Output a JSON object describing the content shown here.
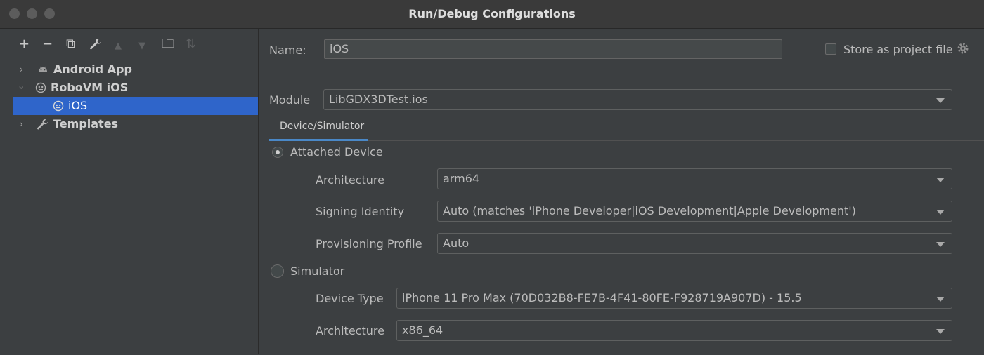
{
  "window": {
    "title": "Run/Debug Configurations"
  },
  "toolbar": {
    "icons": [
      "add-icon",
      "remove-icon",
      "copy-icon",
      "wrench-icon",
      "move-up-icon",
      "move-down-icon",
      "new-folder-icon",
      "sort-icon"
    ],
    "glyphs": {
      "add": "+",
      "remove": "−",
      "copy": "⧉",
      "wrench": "🔧",
      "up": "▲",
      "down": "▼",
      "folder": "🗀",
      "sort": "⇅"
    }
  },
  "tree": {
    "items": [
      {
        "label": "Android App",
        "icon": "android-icon"
      },
      {
        "label": "RoboVM iOS",
        "icon": "robovm-icon"
      },
      {
        "label": "iOS",
        "icon": "robovm-icon"
      },
      {
        "label": "Templates",
        "icon": "wrench-icon"
      }
    ]
  },
  "form": {
    "name_label": "Name:",
    "name_value": "iOS",
    "store_label": "Store as project file",
    "module_label": "Module",
    "module_value": "LibGDX3DTest.ios",
    "tab_label": "Device/Simulator",
    "attached_device_label": "Attached Device",
    "architecture_label": "Architecture",
    "architecture_value": "arm64",
    "signing_label": "Signing Identity",
    "signing_value": "Auto (matches 'iPhone Developer|iOS Development|Apple Development')",
    "provisioning_label": "Provisioning Profile",
    "provisioning_value": "Auto",
    "simulator_label": "Simulator",
    "device_type_label": "Device Type",
    "device_type_value": "iPhone 11 Pro Max (70D032B8-FE7B-4F41-80FE-F928719A907D) - 15.5",
    "sim_architecture_label": "Architecture",
    "sim_architecture_value": "x86_64",
    "attached_selected": true,
    "store_checked": false
  },
  "colors": {
    "selection": "#2f65ca",
    "tab_underline": "#4a88c7",
    "background": "#3c3f41"
  }
}
